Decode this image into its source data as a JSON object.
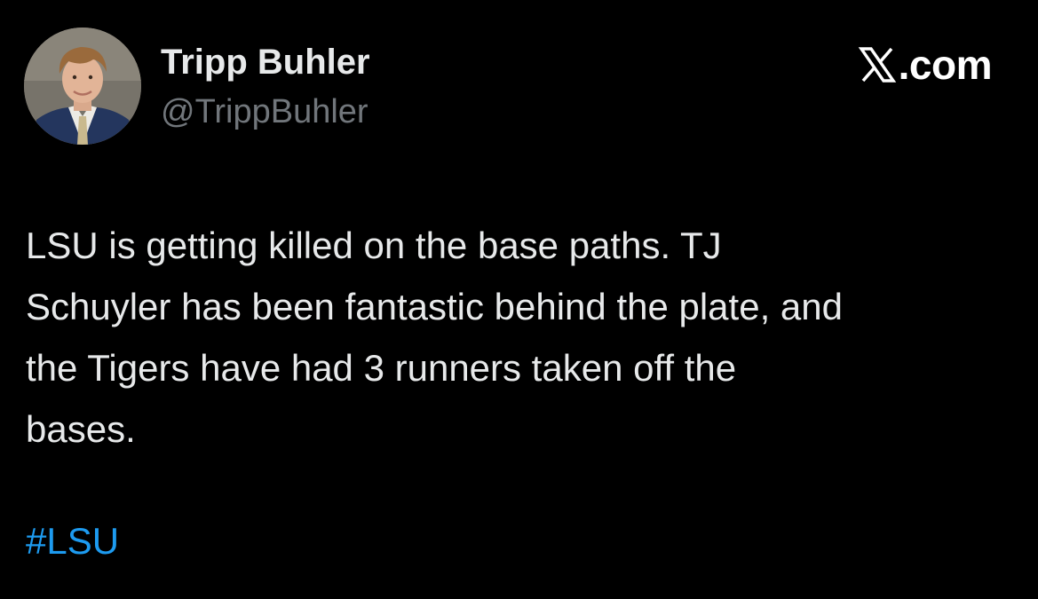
{
  "author": {
    "display_name": "Tripp Buhler",
    "handle": "@TrippBuhler"
  },
  "brand": {
    "icon": "x-logo-icon",
    "label": ".com"
  },
  "tweet": {
    "lines": [
      "LSU is getting killed on the base paths. TJ",
      "Schuyler has been fantastic behind the plate, and",
      "the Tigers have had 3 runners taken off the",
      "bases."
    ],
    "hashtag": "#LSU"
  },
  "colors": {
    "background": "#000000",
    "primary_text": "#e7e9ea",
    "secondary_text": "#71767b",
    "link": "#1d9bf0"
  }
}
